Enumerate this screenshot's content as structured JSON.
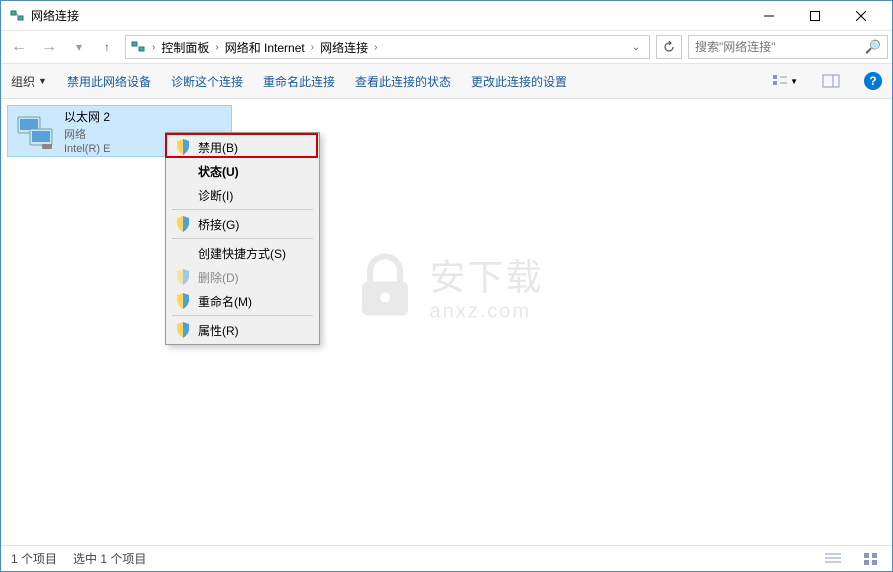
{
  "title": "网络连接",
  "breadcrumb": {
    "b0": "控制面板",
    "b1": "网络和 Internet",
    "b2": "网络连接"
  },
  "search": {
    "placeholder": "搜索\"网络连接\""
  },
  "toolbar": {
    "org": "组织",
    "disable": "禁用此网络设备",
    "diagnose": "诊断这个连接",
    "rename": "重命名此连接",
    "status": "查看此连接的状态",
    "settings": "更改此连接的设置"
  },
  "adapter": {
    "name": "以太网 2",
    "network": "网络",
    "device": "Intel(R) E"
  },
  "menu": {
    "disable": "禁用(B)",
    "status": "状态(U)",
    "diagnose": "诊断(I)",
    "bridge": "桥接(G)",
    "shortcut": "创建快捷方式(S)",
    "delete": "删除(D)",
    "rename": "重命名(M)",
    "properties": "属性(R)"
  },
  "statusbar": {
    "count": "1 个项目",
    "selected": "选中 1 个项目"
  },
  "watermark": {
    "cn": "安下载",
    "en": "anxz.com"
  }
}
